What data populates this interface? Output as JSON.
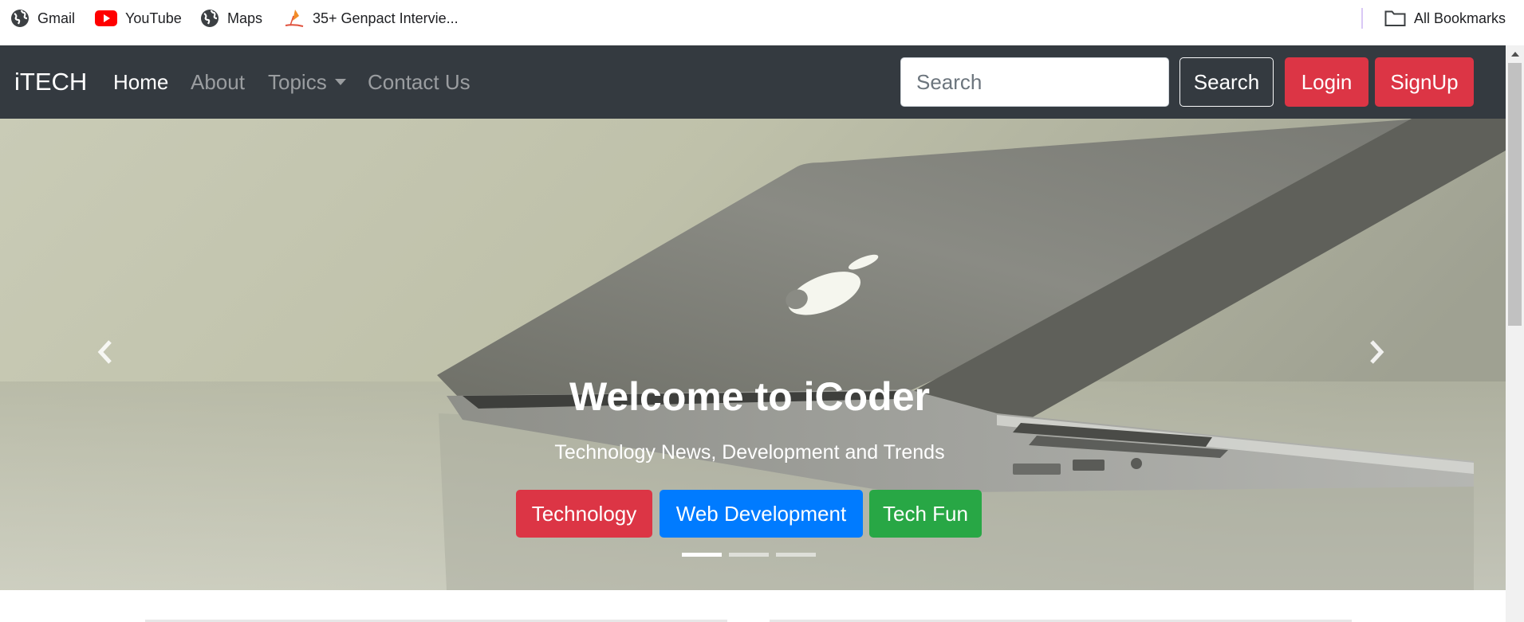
{
  "bookmarks": {
    "items": [
      {
        "label": "Gmail",
        "icon": "globe-icon"
      },
      {
        "label": "YouTube",
        "icon": "youtube-icon"
      },
      {
        "label": "Maps",
        "icon": "globe-icon"
      },
      {
        "label": "35+ Genpact Intervie...",
        "icon": "genpact-icon"
      }
    ],
    "all_bookmarks": "All Bookmarks"
  },
  "navbar": {
    "brand": "iTECH",
    "links": [
      "Home",
      "About",
      "Topics",
      "Contact Us"
    ],
    "search_placeholder": "Search",
    "search_button": "Search",
    "login_button": "Login",
    "signup_button": "SignUp"
  },
  "carousel": {
    "title": "Welcome to iCoder",
    "subtitle": "Technology News, Development and Trends",
    "buttons": [
      "Technology",
      "Web Development",
      "Tech Fun"
    ],
    "button_colors": [
      "#dc3545",
      "#007bff",
      "#28a745"
    ],
    "indicator_count": 3,
    "active_indicator": 1
  },
  "colors": {
    "navbar_bg": "#343a40",
    "danger": "#dc3545",
    "primary": "#007bff",
    "success": "#28a745"
  }
}
